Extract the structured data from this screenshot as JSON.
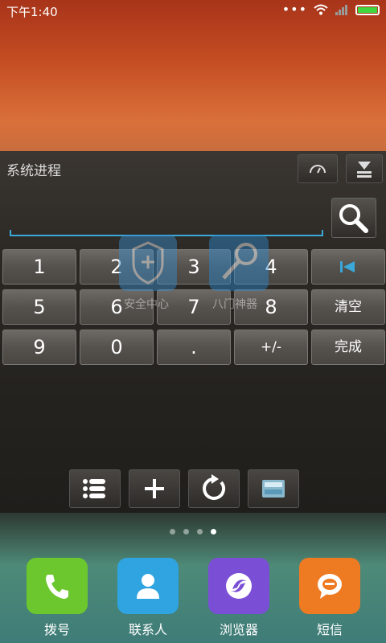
{
  "status_bar": {
    "time": "下午1:40"
  },
  "widget": {
    "title": "系统进程",
    "keys": [
      [
        "1",
        "2",
        "3",
        "4",
        "⇤"
      ],
      [
        "5",
        "6",
        "7",
        "8",
        "清空"
      ],
      [
        "9",
        "0",
        ".",
        "+/-",
        "完成"
      ]
    ]
  },
  "background_apps": [
    {
      "name": "安全中心"
    },
    {
      "name": "八门神器"
    }
  ],
  "page_indicator": {
    "total": 4,
    "active": 4
  },
  "dock": [
    {
      "label": "拨号",
      "color": "#6cc72f",
      "icon": "phone-icon"
    },
    {
      "label": "联系人",
      "color": "#2fa4e0",
      "icon": "contact-icon"
    },
    {
      "label": "浏览器",
      "color": "#7a4fd6",
      "icon": "browser-icon"
    },
    {
      "label": "短信",
      "color": "#ee7a22",
      "icon": "message-icon"
    }
  ]
}
